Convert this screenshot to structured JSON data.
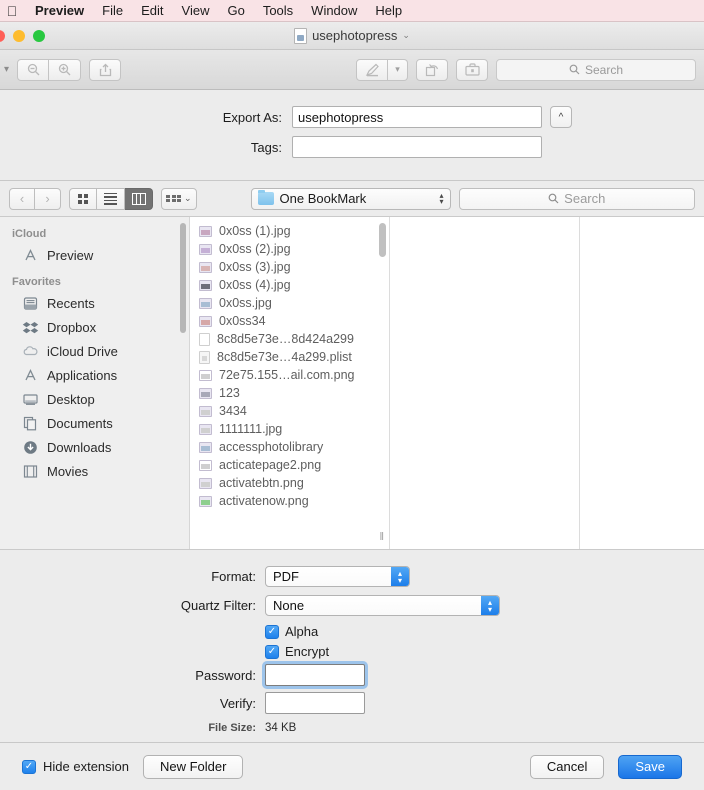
{
  "menubar": {
    "apple_icon": "apple-logo",
    "items": [
      {
        "label": "Preview",
        "bold": true
      },
      {
        "label": "File"
      },
      {
        "label": "Edit"
      },
      {
        "label": "View"
      },
      {
        "label": "Go"
      },
      {
        "label": "Tools"
      },
      {
        "label": "Window"
      },
      {
        "label": "Help"
      }
    ]
  },
  "window": {
    "title": "usephotopress",
    "title_chevron": "⌄",
    "traffic_lights": [
      "close-red",
      "minimize-yellow",
      "maximize-green"
    ]
  },
  "toolbar": {
    "zoom_out_icon": "zoom-out-icon",
    "zoom_in_icon": "zoom-in-icon",
    "share_icon": "share-icon",
    "markup_icon": "markup-pen-icon",
    "markup_chevron": "⌄",
    "rotate_icon": "rotate-icon",
    "toolkit_icon": "toolkit-icon",
    "search_placeholder": "Search",
    "search_icon": "search-icon"
  },
  "sheet": {
    "export_as_label": "Export As:",
    "export_as_value": "usephotopress",
    "tags_label": "Tags:",
    "tags_value": "",
    "disclosure_icon": "^"
  },
  "browser_bar": {
    "back_icon": "‹",
    "forward_icon": "›",
    "view_modes": [
      {
        "name": "icon-view",
        "active": false
      },
      {
        "name": "list-view",
        "active": false
      },
      {
        "name": "column-view",
        "active": true
      }
    ],
    "action_chevron": "⌄",
    "path_label": "One BookMark",
    "path_folder_icon": "folder-icon",
    "search_placeholder": "Search",
    "search_icon": "search-icon"
  },
  "sidebar": {
    "sections": [
      {
        "header": "iCloud",
        "items": [
          {
            "label": "Preview",
            "icon": "applications-icon"
          }
        ]
      },
      {
        "header": "Favorites",
        "items": [
          {
            "label": "Recents",
            "icon": "recents-icon"
          },
          {
            "label": "Dropbox",
            "icon": "dropbox-icon"
          },
          {
            "label": "iCloud Drive",
            "icon": "cloud-icon"
          },
          {
            "label": "Applications",
            "icon": "applications-icon"
          },
          {
            "label": "Desktop",
            "icon": "desktop-icon"
          },
          {
            "label": "Documents",
            "icon": "documents-icon"
          },
          {
            "label": "Downloads",
            "icon": "downloads-icon"
          },
          {
            "label": "Movies",
            "icon": "movies-icon"
          }
        ]
      }
    ]
  },
  "files": [
    {
      "name": "0x0ss (1).jpg",
      "icon": "image-file-icon",
      "tint": "c1"
    },
    {
      "name": "0x0ss (2).jpg",
      "icon": "image-file-icon",
      "tint": "c2"
    },
    {
      "name": "0x0ss (3).jpg",
      "icon": "image-file-icon",
      "tint": "c3"
    },
    {
      "name": "0x0ss (4).jpg",
      "icon": "image-file-icon",
      "tint": "c4"
    },
    {
      "name": "0x0ss.jpg",
      "icon": "image-file-icon",
      "tint": "c5"
    },
    {
      "name": "0x0ss34",
      "icon": "image-file-icon",
      "tint": "c6"
    },
    {
      "name": "8c8d5e73e…8d424a299",
      "icon": "generic-file-icon",
      "tint": "doc"
    },
    {
      "name": "8c8d5e73e…4a299.plist",
      "icon": "plist-file-icon",
      "tint": "plist"
    },
    {
      "name": "72e75.155…ail.com.png",
      "icon": "image-file-icon",
      "tint": "mono"
    },
    {
      "name": "123",
      "icon": "image-file-icon",
      "tint": "c7"
    },
    {
      "name": "3434",
      "icon": "image-file-icon",
      "tint": "gray"
    },
    {
      "name": "1111111.jpg",
      "icon": "image-file-icon",
      "tint": "gray"
    },
    {
      "name": "accessphotolibrary",
      "icon": "image-file-icon",
      "tint": "c5"
    },
    {
      "name": "acticatepage2.png",
      "icon": "image-file-icon",
      "tint": "mono"
    },
    {
      "name": "activatebtn.png",
      "icon": "image-file-icon",
      "tint": "gray"
    },
    {
      "name": "activatenow.png",
      "icon": "image-file-icon",
      "tint": "green"
    }
  ],
  "options": {
    "format_label": "Format:",
    "format_value": "PDF",
    "quartz_filter_label": "Quartz Filter:",
    "quartz_filter_value": "None",
    "alpha_label": "Alpha",
    "alpha_checked": true,
    "encrypt_label": "Encrypt",
    "encrypt_checked": true,
    "password_label": "Password:",
    "password_value": "",
    "verify_label": "Verify:",
    "verify_value": "",
    "file_size_label": "File Size:",
    "file_size_value": "34 KB",
    "checkmark": "✓",
    "stepper_up": "▴",
    "stepper_down": "▾"
  },
  "bottom": {
    "hide_extension_label": "Hide extension",
    "hide_extension_checked": true,
    "new_folder_label": "New Folder",
    "cancel_label": "Cancel",
    "save_label": "Save",
    "checkmark": "✓"
  },
  "colors": {
    "accent_blue": "#1f81ec",
    "menubar_pink": "#f9e3e6",
    "window_gray": "#ececec",
    "focus_ring": "#5ca4eb"
  }
}
